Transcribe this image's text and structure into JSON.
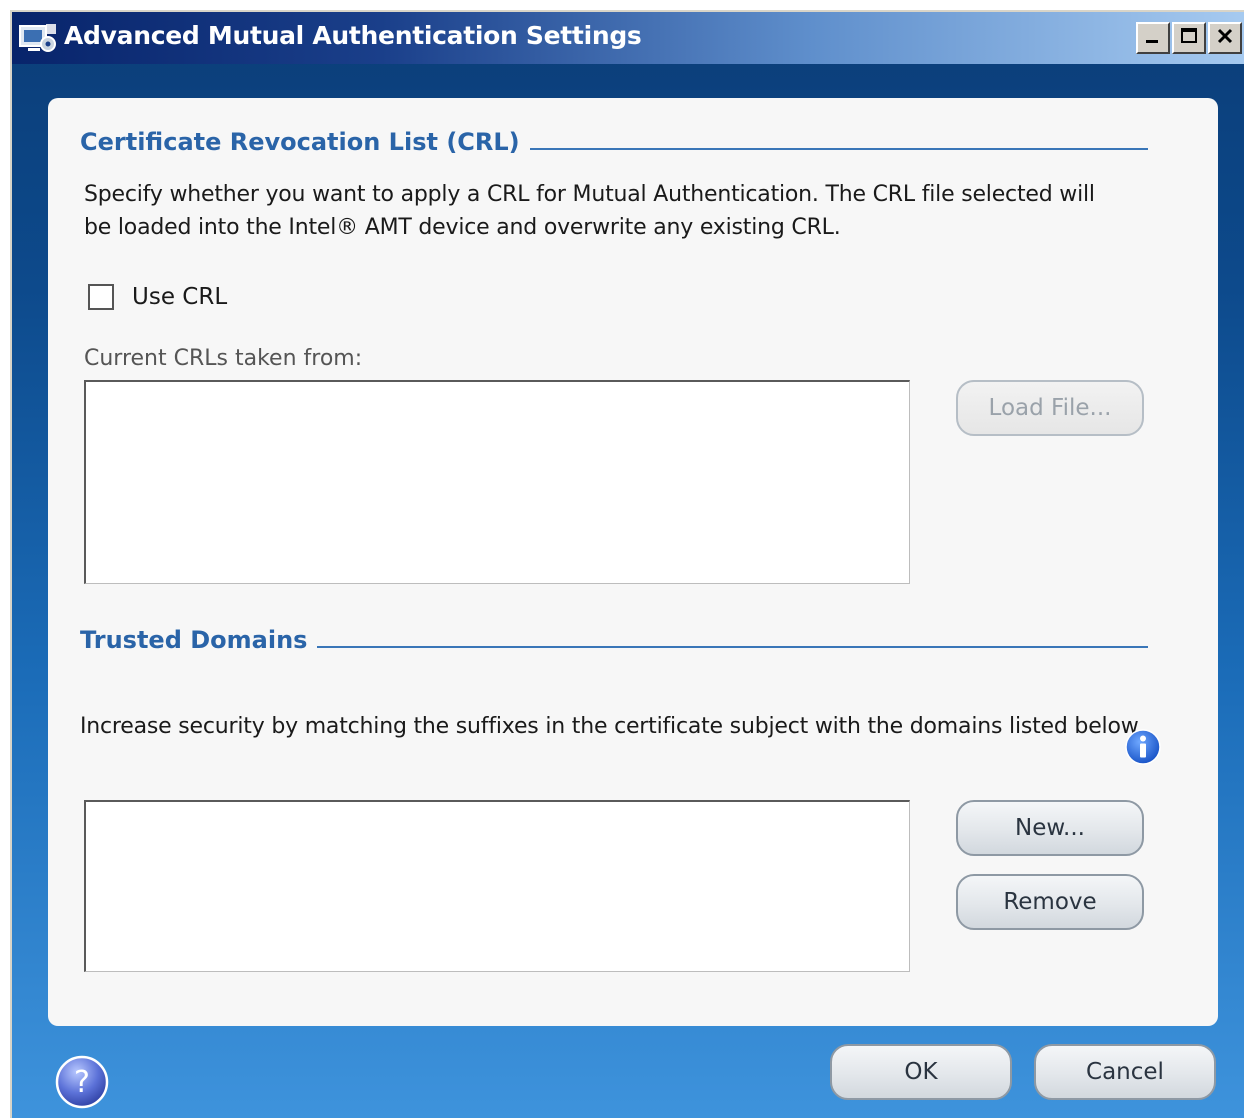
{
  "window": {
    "title": "Advanced Mutual Authentication Settings",
    "icon": "settings-app-icon",
    "controls": {
      "minimize_icon": "minimize-icon",
      "maximize_icon": "maximize-icon",
      "close_icon": "close-icon"
    }
  },
  "crl_section": {
    "title": "Certificate Revocation List (CRL)",
    "description": "Specify whether you want to apply a CRL for Mutual Authentication. The CRL file selected will be loaded into the Intel® AMT device and overwrite any existing CRL.",
    "use_crl_label": "Use CRL",
    "use_crl_checked": false,
    "current_label": "Current CRLs taken from:",
    "current_value": "",
    "load_file_label": "Load File...",
    "load_file_enabled": false
  },
  "domains_section": {
    "title": "Trusted Domains",
    "description": "Increase security by matching the suffixes in the certificate subject with the domains listed below.",
    "domains": [],
    "new_label": "New...",
    "remove_label": "Remove",
    "info_icon": "info-icon"
  },
  "footer": {
    "help_icon": "help-icon",
    "ok_label": "OK",
    "cancel_label": "Cancel"
  },
  "colors": {
    "section_title": "#2a64a8",
    "section_line": "#3a76b8",
    "window_gradient_top": "#0b3d78",
    "window_gradient_bottom": "#3e93dc"
  }
}
